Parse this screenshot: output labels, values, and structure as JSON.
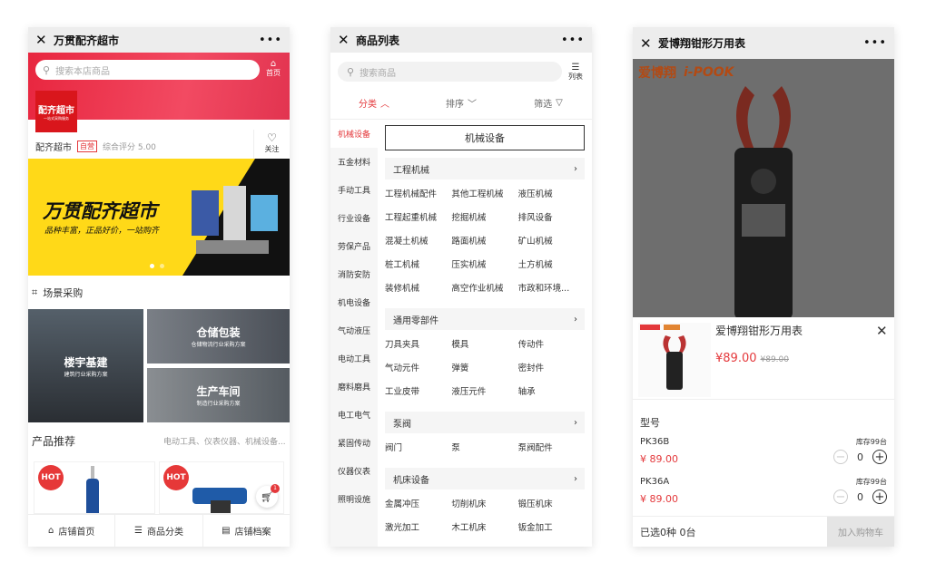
{
  "p1": {
    "title": "万贯配齐超市",
    "search_ph": "搜索本店商品",
    "home": "首页",
    "logo_top": "配齐超市",
    "logo_sub": "一站式采购服务",
    "store": "配齐超市",
    "tag": "自营",
    "score": "综合评分 5.00",
    "follow": "关注",
    "banner_title": "万贯配齐超市",
    "banner_sub": "品种丰富，正品好价，一站购齐",
    "scene": "场景采购",
    "tiles": [
      {
        "t": "楼宇基建",
        "s": "建筑行业采购方案"
      },
      {
        "t": "仓储包装",
        "s": "仓储物流行业采购方案"
      },
      {
        "t": "生产车间",
        "s": "制造行业采购方案"
      }
    ],
    "rec": "产品推荐",
    "rec_sub": "电动工具、仪表仪器、机械设备...",
    "hot": "HOT",
    "cart_badge": "1",
    "nav": [
      "店铺首页",
      "商品分类",
      "店铺档案"
    ]
  },
  "p2": {
    "title": "商品列表",
    "search_ph": "搜索商品",
    "list": "列表",
    "filters": [
      "分类",
      "排序",
      "筛选"
    ],
    "cats": [
      "机械设备",
      "五金材料",
      "手动工具",
      "行业设备",
      "劳保产品",
      "消防安防",
      "机电设备",
      "气动液压",
      "电动工具",
      "磨料磨具",
      "电工电气",
      "紧固传动",
      "仪器仪表",
      "照明设施"
    ],
    "header": "机械设备",
    "groups": [
      {
        "name": "工程机械",
        "items": [
          "工程机械配件",
          "其他工程机械",
          "液压机械",
          "工程起重机械",
          "挖掘机械",
          "排风设备",
          "混凝土机械",
          "路面机械",
          "矿山机械",
          "桩工机械",
          "压实机械",
          "土方机械",
          "装修机械",
          "高空作业机械",
          "市政和环境..."
        ]
      },
      {
        "name": "通用零部件",
        "items": [
          "刀具夹具",
          "模具",
          "传动件",
          "气动元件",
          "弹簧",
          "密封件",
          "工业皮带",
          "液压元件",
          "轴承"
        ]
      },
      {
        "name": "泵阀",
        "items": [
          "阀门",
          "泵",
          "泵阀配件"
        ]
      },
      {
        "name": "机床设备",
        "items": [
          "金属冲压",
          "切削机床",
          "锻压机床",
          "激光加工",
          "木工机床",
          "钣金加工"
        ]
      }
    ]
  },
  "p3": {
    "title": "爱博翔钳形万用表",
    "brand": "爱博翔",
    "brand_en": "i-POOK",
    "product": "爱博翔钳形万用表",
    "price": "¥89.00",
    "old": "¥89.00",
    "model": "型号",
    "variants": [
      {
        "name": "PK36B",
        "price": "¥ 89.00",
        "stock": "库存99台",
        "qty": "0"
      },
      {
        "name": "PK36A",
        "price": "¥ 89.00",
        "stock": "库存99台",
        "qty": "0"
      }
    ],
    "selected": "已选0种 0台",
    "add": "加入购物车"
  },
  "colors": {
    "accent": "#e4393c",
    "banner": "#ffd918"
  }
}
